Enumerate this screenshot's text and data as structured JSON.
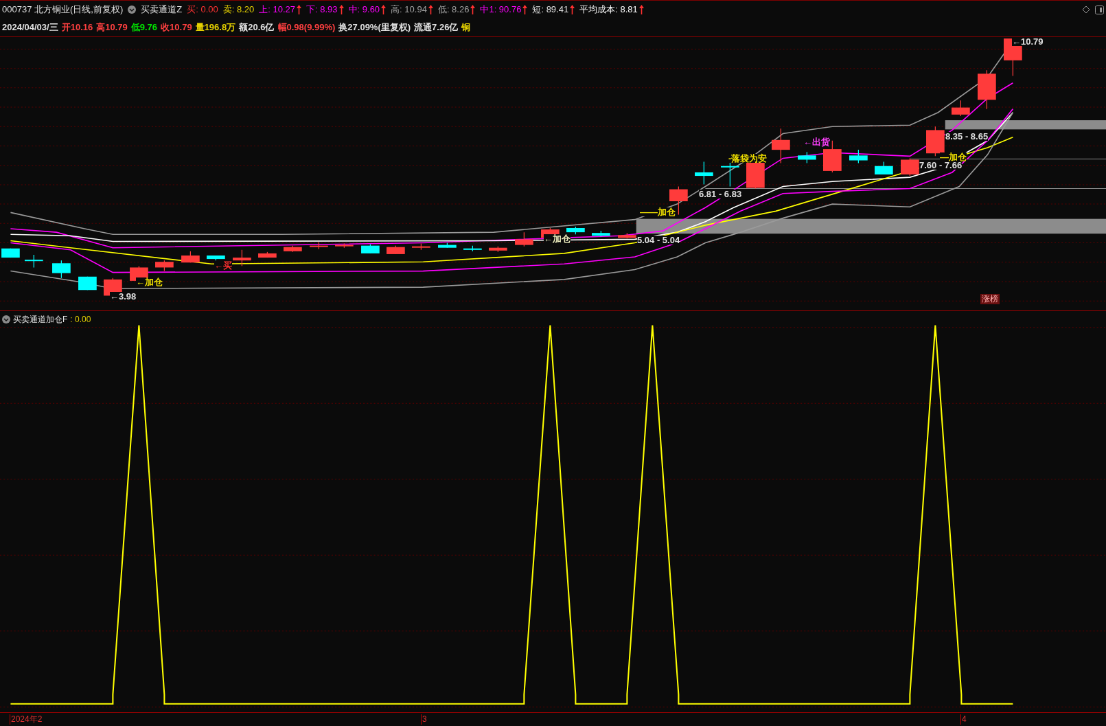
{
  "title_bar": {
    "stock": "000737 北方铜业(日线,前复权)",
    "indicator": "买卖通道Z",
    "fields": [
      {
        "label": "买:",
        "value": "0.00",
        "color": "#ff3232",
        "rising": false
      },
      {
        "label": "卖:",
        "value": "8.20",
        "color": "#e6d200",
        "rising": false
      },
      {
        "label": "上:",
        "value": "10.27",
        "color": "#ff00ff",
        "rising": true
      },
      {
        "label": "下:",
        "value": "8.93",
        "color": "#ff00ff",
        "rising": true
      },
      {
        "label": "中:",
        "value": "9.60",
        "color": "#ff00ff",
        "rising": true
      },
      {
        "label": "高:",
        "value": "10.94",
        "color": "#a0a0a0",
        "rising": true
      },
      {
        "label": "低:",
        "value": "8.26",
        "color": "#a0a0a0",
        "rising": true
      },
      {
        "label": "中1:",
        "value": "90.76",
        "color": "#ff00ff",
        "rising": true
      },
      {
        "label": "短:",
        "value": "89.41",
        "color": "#e0e0e0",
        "rising": true
      },
      {
        "label": "平均成本:",
        "value": "8.81",
        "color": "#ffffff",
        "rising": true
      }
    ]
  },
  "quote_line": [
    {
      "text": "2024/04/03/三",
      "color": "#e0e0e0"
    },
    {
      "text": "开10.16",
      "color": "#ff4040"
    },
    {
      "text": "高10.79",
      "color": "#ff4040"
    },
    {
      "text": "低9.76",
      "color": "#00e600"
    },
    {
      "text": "收10.79",
      "color": "#ff4040"
    },
    {
      "text": "量196.8万",
      "color": "#e6d200"
    },
    {
      "text": "额20.6亿",
      "color": "#e0e0e0"
    },
    {
      "text": "幅0.98(9.99%)",
      "color": "#ff4040"
    },
    {
      "text": "换27.09%(里复权)",
      "color": "#e0e0e0"
    },
    {
      "text": "流通7.26亿",
      "color": "#e0e0e0"
    },
    {
      "text": "铜",
      "color": "#e6d200"
    }
  ],
  "annotations": [
    {
      "text": "←10.79",
      "color": "#e0e0e0"
    },
    {
      "text": "6.81 - 6.83",
      "color": "#e0e0e0"
    },
    {
      "text": "——加仓",
      "color": "#f0e000"
    },
    {
      "text": "5.04 - 5.04",
      "color": "#e0e0e0"
    },
    {
      "text": "-落袋为安",
      "color": "#f0e000"
    },
    {
      "text": "←出货",
      "color": "#ff40ff"
    },
    {
      "text": "8.35 - 8.65",
      "color": "#e0e0e0"
    },
    {
      "text": "7.60 - 7.66",
      "color": "#e0e0e0"
    },
    {
      "text": "—加仓",
      "color": "#f0e000"
    },
    {
      "text": "←加仓",
      "color": "#f0f0c0"
    },
    {
      "text": "←加仓",
      "color": "#f0e000"
    },
    {
      "text": "←3.98",
      "color": "#e0e0e0"
    },
    {
      "text": "←买",
      "color": "#ff3030"
    }
  ],
  "badge": "涨榜",
  "indicator_panel": {
    "name": "买卖通道加仓F",
    "value": ": 0.00"
  },
  "x_axis": {
    "labels": [
      "2024年2",
      "3",
      "4"
    ]
  }
}
